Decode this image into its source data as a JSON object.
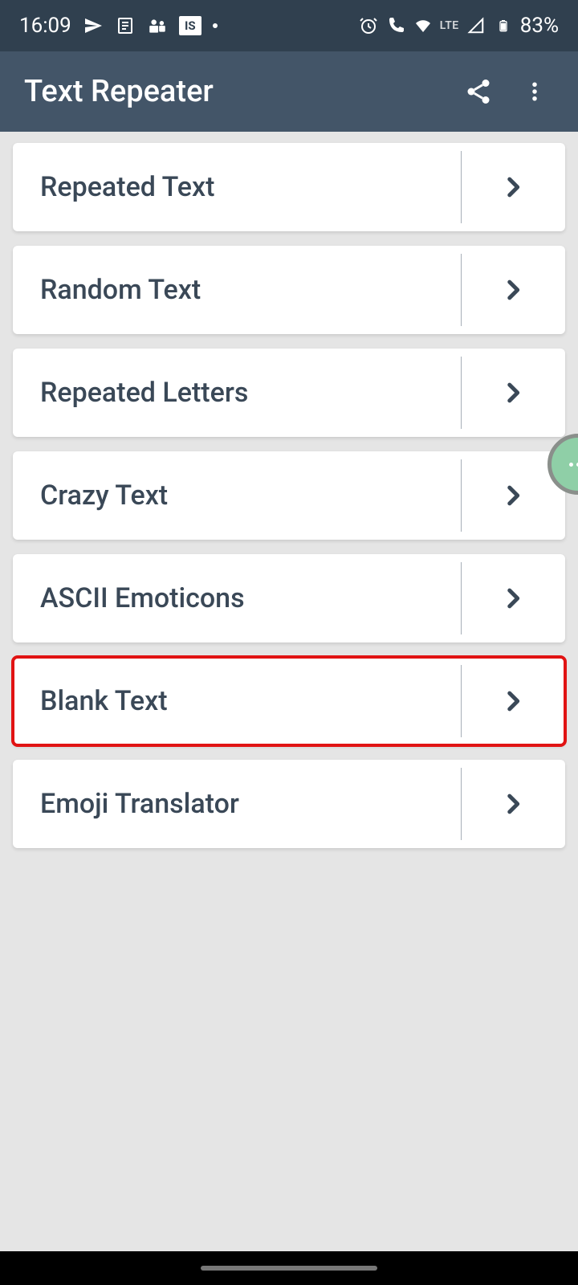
{
  "status": {
    "time": "16:09",
    "network_label": "LTE",
    "battery": "83%"
  },
  "header": {
    "title": "Text Repeater"
  },
  "menu": {
    "items": [
      {
        "label": "Repeated Text",
        "highlighted": false
      },
      {
        "label": "Random Text",
        "highlighted": false
      },
      {
        "label": "Repeated Letters",
        "highlighted": false
      },
      {
        "label": "Crazy Text",
        "highlighted": false
      },
      {
        "label": "ASCII Emoticons",
        "highlighted": false
      },
      {
        "label": "Blank Text",
        "highlighted": true
      },
      {
        "label": "Emoji Translator",
        "highlighted": false
      }
    ]
  }
}
